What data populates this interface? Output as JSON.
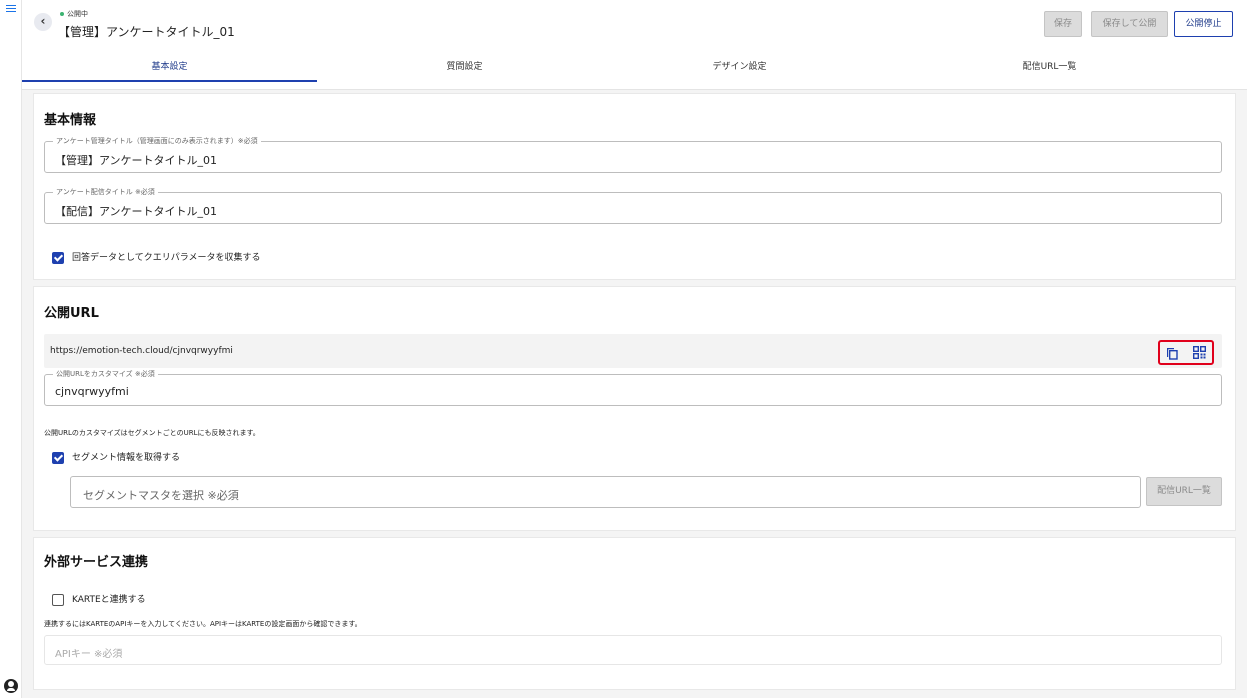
{
  "header": {
    "status": "公開中",
    "title": "【管理】アンケートタイトル_01",
    "buttons": {
      "save": "保存",
      "save_publish": "保存して公開",
      "unpublish": "公開停止"
    }
  },
  "tabs": [
    {
      "label": "基本設定",
      "active": true
    },
    {
      "label": "質問設定",
      "active": false
    },
    {
      "label": "デザイン設定",
      "active": false
    },
    {
      "label": "配信URL一覧",
      "active": false
    }
  ],
  "basic_info": {
    "heading": "基本情報",
    "admin_title": {
      "label": "アンケート管理タイトル（管理画面にのみ表示されます）※必須",
      "value": "【管理】アンケートタイトル_01"
    },
    "delivery_title": {
      "label": "アンケート配信タイトル ※必須",
      "value": "【配信】アンケートタイトル_01"
    },
    "query_param_checkbox": {
      "label": "回答データとしてクエリパラメータを収集する",
      "checked": true
    }
  },
  "public_url": {
    "heading": "公開URL",
    "url": "https://emotion-tech.cloud/cjnvqrwyyfmi",
    "customize": {
      "label": "公開URLをカスタマイズ ※必須",
      "value": "cjnvqrwyyfmi"
    },
    "note": "公開URLのカスタマイズはセグメントごとのURLにも反映されます。",
    "segment_checkbox": {
      "label": "セグメント情報を取得する",
      "checked": true
    },
    "segment_select": {
      "placeholder": "セグメントマスタを選択 ※必須"
    },
    "segment_button": "配信URL一覧",
    "icons": [
      "copy-icon",
      "qr-code-icon"
    ]
  },
  "external": {
    "heading": "外部サービス連携",
    "karte_checkbox": {
      "label": "KARTEと連携する",
      "checked": false
    },
    "note": "連携するにはKARTEのAPIキーを入力してください。APIキーはKARTEの設定画面から確認できます。",
    "api_key": {
      "placeholder": "APIキー ※必須"
    }
  },
  "colors": {
    "accent": "#1e40af",
    "highlight": "#e0001b",
    "status_dot": "#3cb371"
  }
}
